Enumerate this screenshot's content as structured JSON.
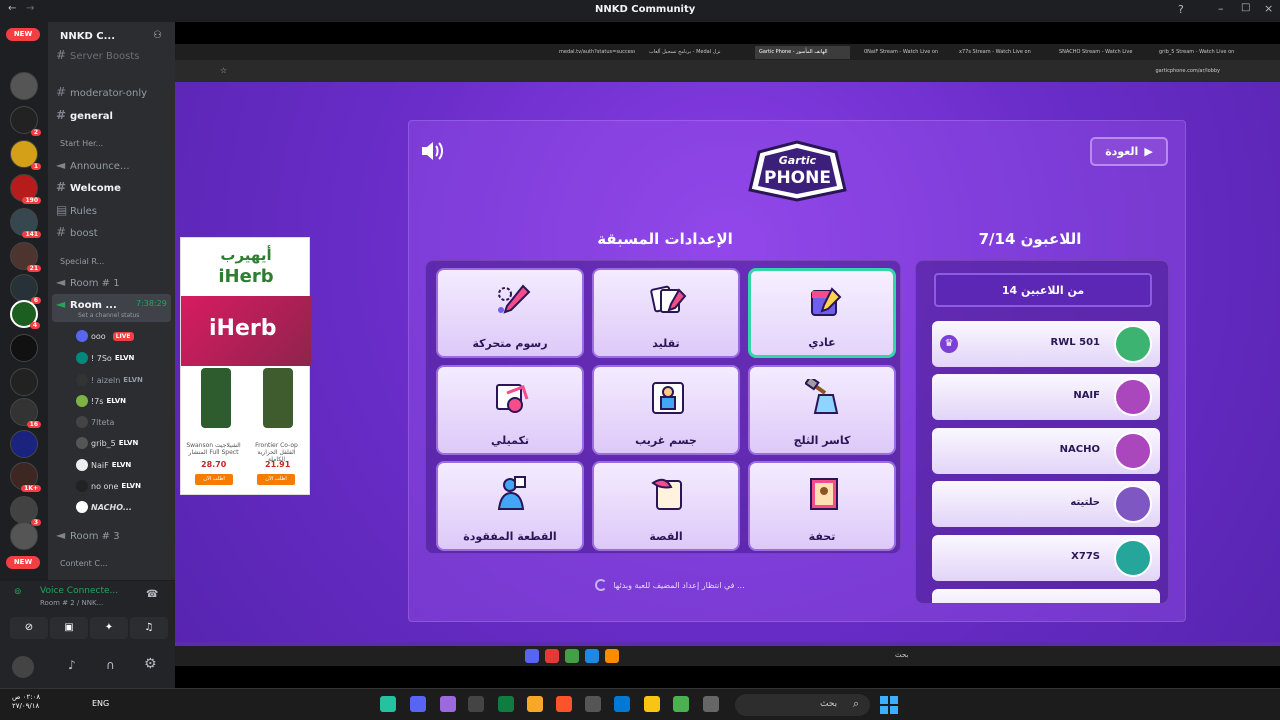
{
  "window": {
    "title": "NNKD Community"
  },
  "discord": {
    "new_pill": "NEW",
    "server_name": "NNKD C...",
    "channels": {
      "server_boosts": "Server Boosts",
      "moderator_only": "moderator-only",
      "general": "general",
      "start_here": "Start Her...",
      "announce": "Announce...",
      "welcome": "Welcome",
      "rules": "Rules",
      "boost": "boost",
      "special": "Special R...",
      "room1": "Room # 1",
      "room_active": "Room ...",
      "room_active_time": "7:38:29",
      "channel_status": "Set a channel status",
      "room3": "Room # 3",
      "content": "Content C..."
    },
    "voice_users": [
      {
        "name": "ooo",
        "tag": "",
        "live": "LIVE"
      },
      {
        "name": "! 7So",
        "tag": "ELVN"
      },
      {
        "name": "! aizeln",
        "tag": "ELVN"
      },
      {
        "name": "!7s",
        "tag": "ELVN"
      },
      {
        "name": "7lteta",
        "tag": ""
      },
      {
        "name": "grib_5",
        "tag": "ELVN"
      },
      {
        "name": "NaiF",
        "tag": "ELVN"
      },
      {
        "name": "no one",
        "tag": "ELVN"
      },
      {
        "name": "NACHO...",
        "tag": ""
      }
    ],
    "voice": {
      "status": "Voice Connecte...",
      "room": "Room # 2 / NNK..."
    },
    "badges": [
      "2",
      "1",
      "190",
      "141",
      "21",
      "6",
      "4",
      "3",
      "16",
      "1K+",
      "3"
    ]
  },
  "browser": {
    "tabs": [
      "medal.tv/auth?status=success",
      "برنامج تسجيل ألعاب - Medal نزل",
      "Gartic Phone - الهاتف المأسور",
      "0NaiF Stream - Watch Live on",
      "x77s Stream - Watch Live on",
      "SNACHO Stream - Watch Live",
      "grib_5 Stream - Watch Live on"
    ],
    "url": "garticphone.com/ar/lobby"
  },
  "ad": {
    "brand_ar": "أيهيرب",
    "brand": "iHerb",
    "products": [
      {
        "name": "Swanson الشيلاجيت المنشار Full Spect",
        "price": "28.70",
        "cta": "اطلب الآن"
      },
      {
        "name": "Frontier Co-op الفلفل الحرارية الكاملة",
        "price": "21.91",
        "cta": "اطلب الآن"
      }
    ]
  },
  "gartic": {
    "logo_top": "Gartic",
    "logo_bottom": "PHONE",
    "back_label": "العودة",
    "presets_title": "الإعدادات المسبقة",
    "players_title": "اللاعبون 7/14",
    "max_players": "14 من اللاعبين",
    "presets": [
      {
        "label": "عادي",
        "selected": true
      },
      {
        "label": "تقليد",
        "selected": false
      },
      {
        "label": "رسوم متحركة",
        "selected": false
      },
      {
        "label": "كاسر الثلج",
        "selected": false
      },
      {
        "label": "جسم غريب",
        "selected": false
      },
      {
        "label": "تكميلي",
        "selected": false
      },
      {
        "label": "تحفة",
        "selected": false
      },
      {
        "label": "القصة",
        "selected": false
      },
      {
        "label": "القطعة المفقودة",
        "selected": false
      }
    ],
    "players": [
      "RWL 501",
      "NAIF",
      "NACHO",
      "حلتيته",
      "X77S"
    ],
    "waiting": "في انتظار إعداد المضيف للعبة وبدئها ..."
  },
  "taskbar": {
    "lang": "ENG",
    "search": "بحث",
    "clock_time": "٠٢:٠٨ ص",
    "clock_date": "٢٧/٠٩/١٨"
  },
  "colors": {
    "accent": "#5b2bb0",
    "selected": "#33d6a6",
    "discord_bg": "#2b2d31"
  }
}
